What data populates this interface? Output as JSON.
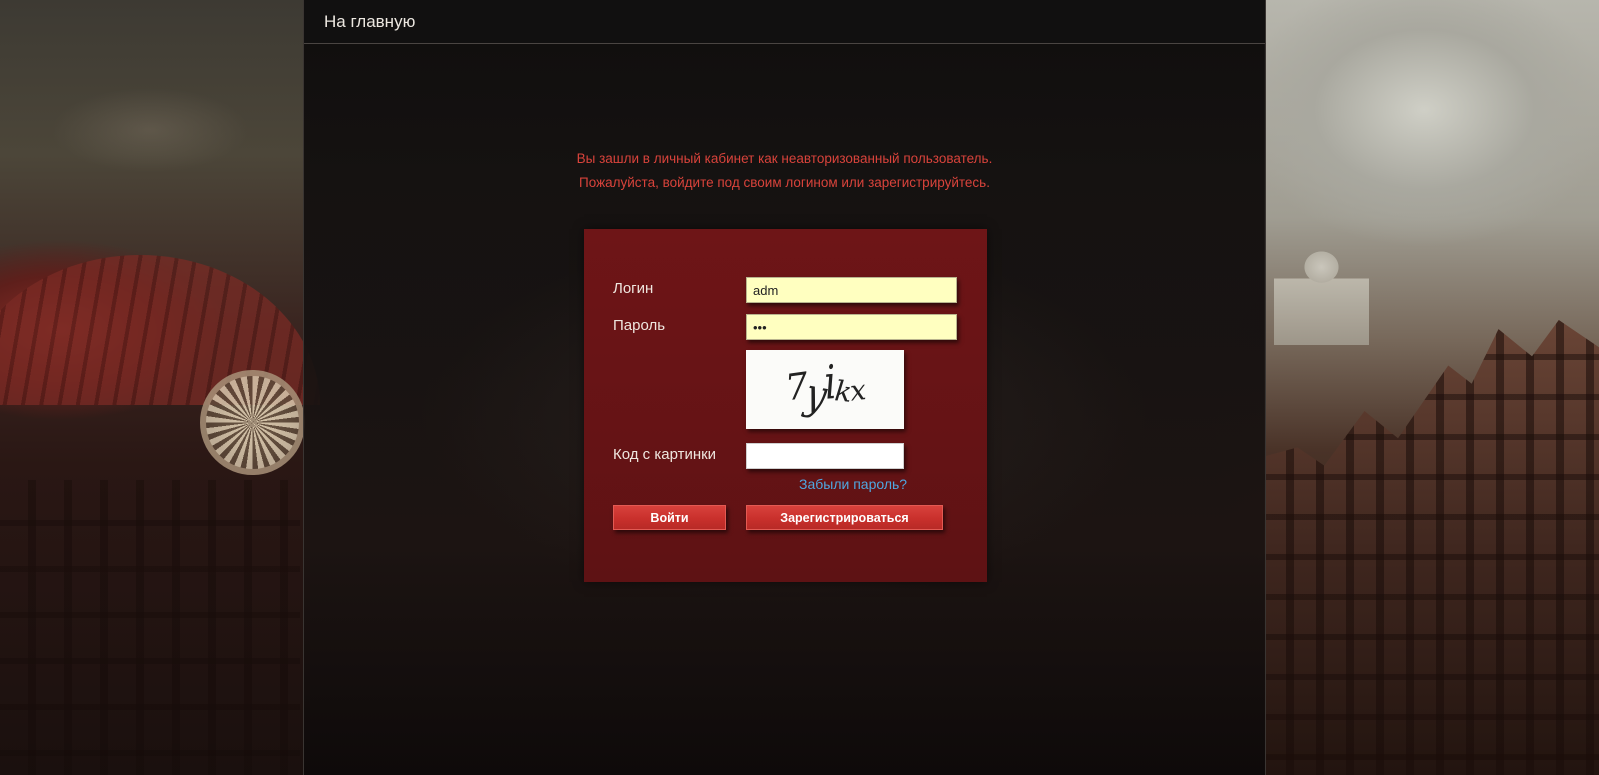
{
  "header": {
    "home_link": "На главную"
  },
  "notice": {
    "line1": "Вы зашли в личный кабинет как неавторизованный пользователь.",
    "line2": "Пожалуйста, войдите под своим логином или зарегистрируйтесь."
  },
  "form": {
    "login_label": "Логин",
    "login_value": "adm",
    "password_label": "Пароль",
    "password_value": "•••",
    "captcha_text": "7yikx",
    "captcha_label": "Код с картинки",
    "captcha_value": "",
    "forgot_link": "Забыли пароль?",
    "login_button": "Войти",
    "register_button": "Зарегистрироваться"
  },
  "colors": {
    "notice_text": "#d8433b",
    "form_background": "#6a1416",
    "input_background": "#ffffc0",
    "button_background": "#c9302c",
    "link": "#4fa7e0"
  }
}
